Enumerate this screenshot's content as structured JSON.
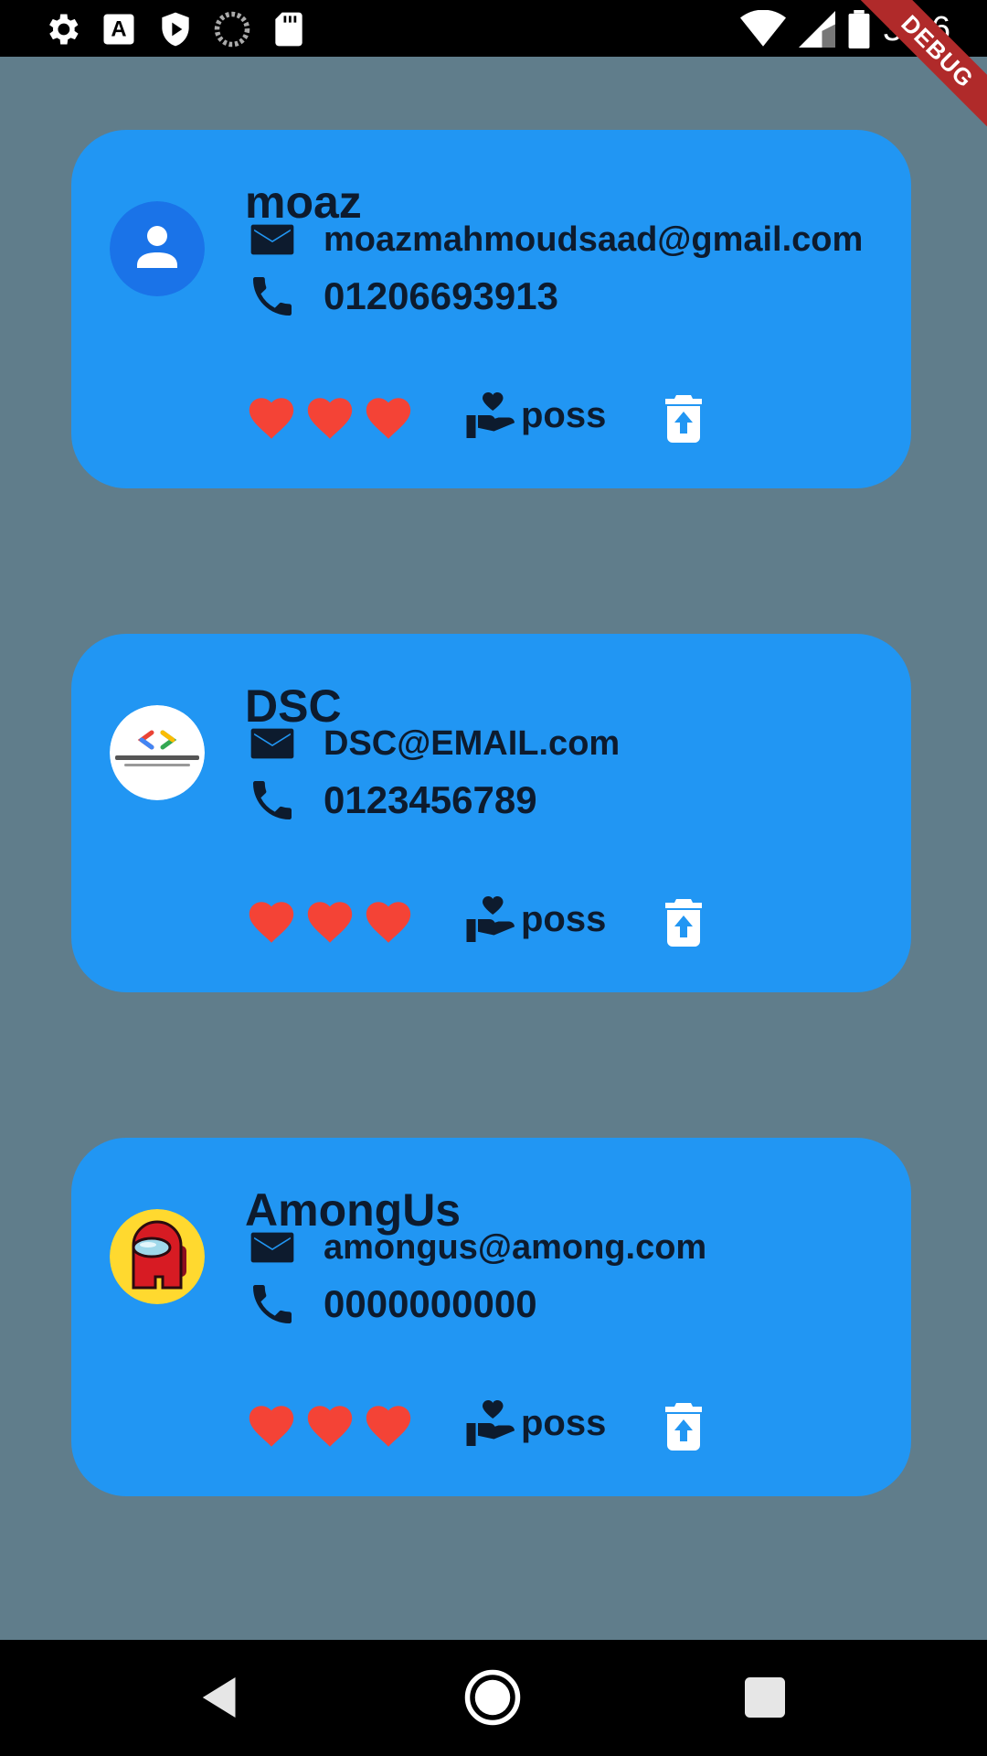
{
  "status_bar": {
    "time": "3:16",
    "icons_left": [
      "settings-icon",
      "font-a-icon",
      "play-protect-icon",
      "loading-circle-icon",
      "sd-card-icon"
    ],
    "icons_right": [
      "wifi-icon",
      "cell-signal-icon",
      "battery-icon"
    ]
  },
  "debug_banner": "DEBUG",
  "contacts": [
    {
      "name": "moaz",
      "email": "moazmahmoudsaad@gmail.com",
      "phone": "01206693913",
      "avatar": "person-avatar",
      "hearts": 3,
      "poss_label": "poss"
    },
    {
      "name": "DSC",
      "email": "DSC@EMAIL.com",
      "phone": "0123456789",
      "avatar": "dsc-logo-avatar",
      "hearts": 3,
      "poss_label": "poss"
    },
    {
      "name": "AmongUs",
      "email": "amongus@among.com",
      "phone": "0000000000",
      "avatar": "among-us-avatar",
      "hearts": 3,
      "poss_label": "poss"
    }
  ],
  "colors": {
    "background": "#607d8b",
    "card": "#2196f3",
    "text": "#0d1b2e",
    "heart": "#f44336",
    "debug_banner": "#b02a2a"
  },
  "nav_bar": {
    "buttons": [
      "back-icon",
      "home-icon",
      "recents-icon"
    ]
  }
}
